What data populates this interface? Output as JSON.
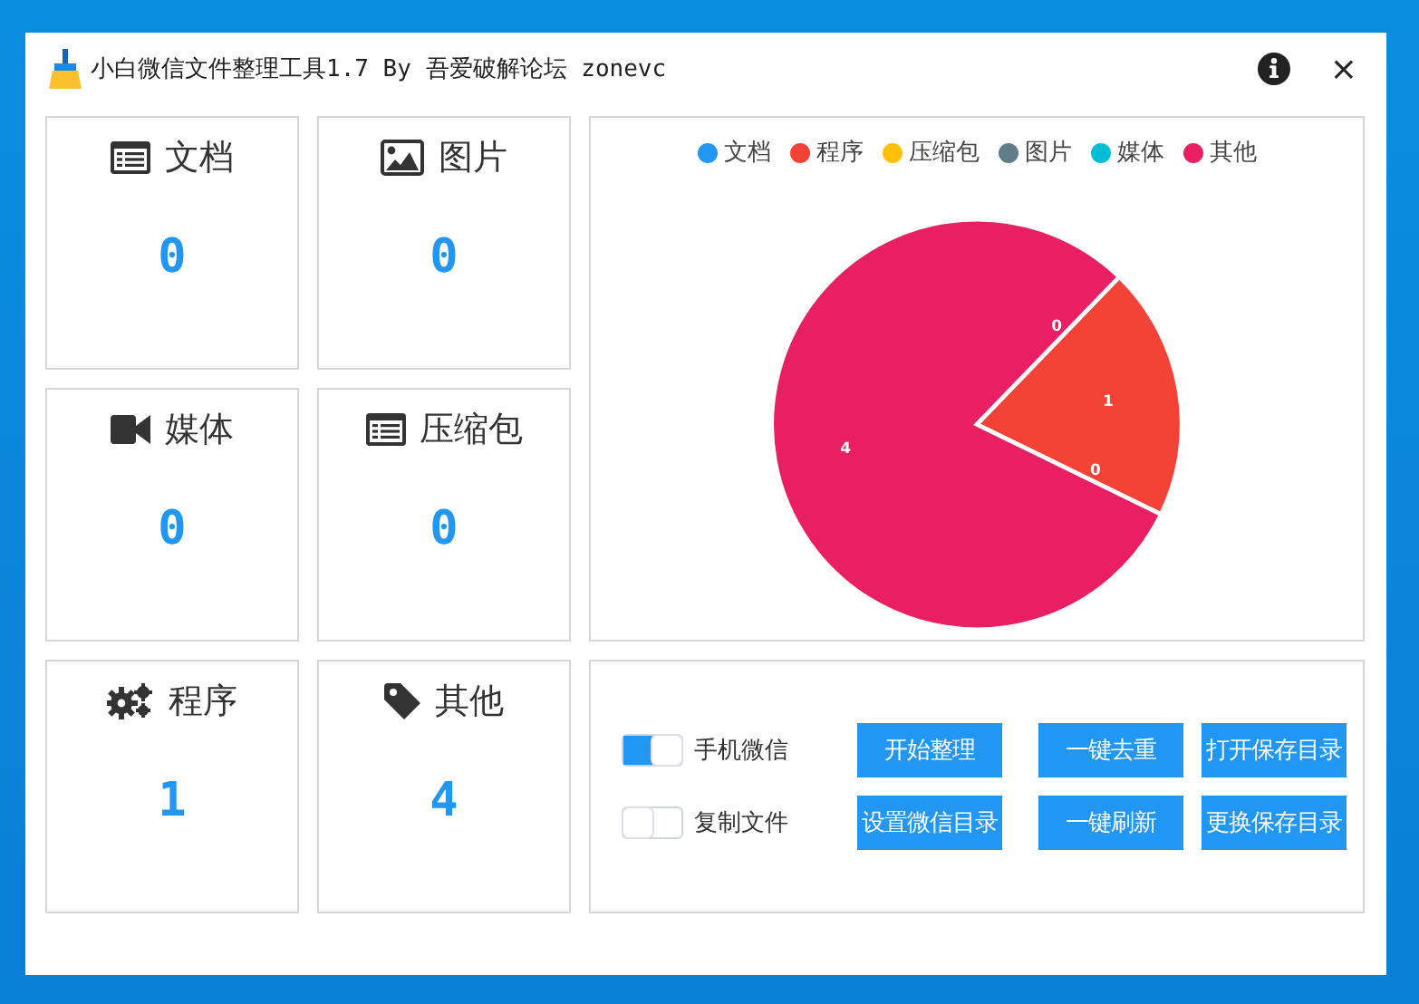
{
  "window": {
    "title": "小白微信文件整理工具1.7 By 吾爱破解论坛 zonevc",
    "close": "×"
  },
  "cards": [
    {
      "kind": "doc",
      "label": "文档",
      "count": "0"
    },
    {
      "kind": "image",
      "label": "图片",
      "count": "0"
    },
    {
      "kind": "video",
      "label": "媒体",
      "count": "0"
    },
    {
      "kind": "doc",
      "label": "压缩包",
      "count": "0"
    },
    {
      "kind": "gears",
      "label": "程序",
      "count": "1"
    },
    {
      "kind": "tag",
      "label": "其他",
      "count": "4"
    }
  ],
  "chart": {
    "chart_data": {
      "type": "pie",
      "categories": [
        "文档",
        "程序",
        "压缩包",
        "图片",
        "媒体",
        "其他"
      ],
      "values": [
        0,
        1,
        0,
        0,
        0,
        4
      ],
      "colors": [
        "#2196f3",
        "#f44336",
        "#ffc107",
        "#607d8b",
        "#00bcd4",
        "#e91e63"
      ],
      "value_labels": [
        "0",
        "1",
        "0",
        null,
        null,
        "4"
      ]
    }
  },
  "switches": [
    {
      "label": "手机微信",
      "on": true
    },
    {
      "label": "复制文件",
      "on": false
    }
  ],
  "buttons": [
    [
      "开始整理",
      "一键去重",
      "打开保存目录"
    ],
    [
      "设置微信目录",
      "一键刷新",
      "更换保存目录"
    ]
  ]
}
